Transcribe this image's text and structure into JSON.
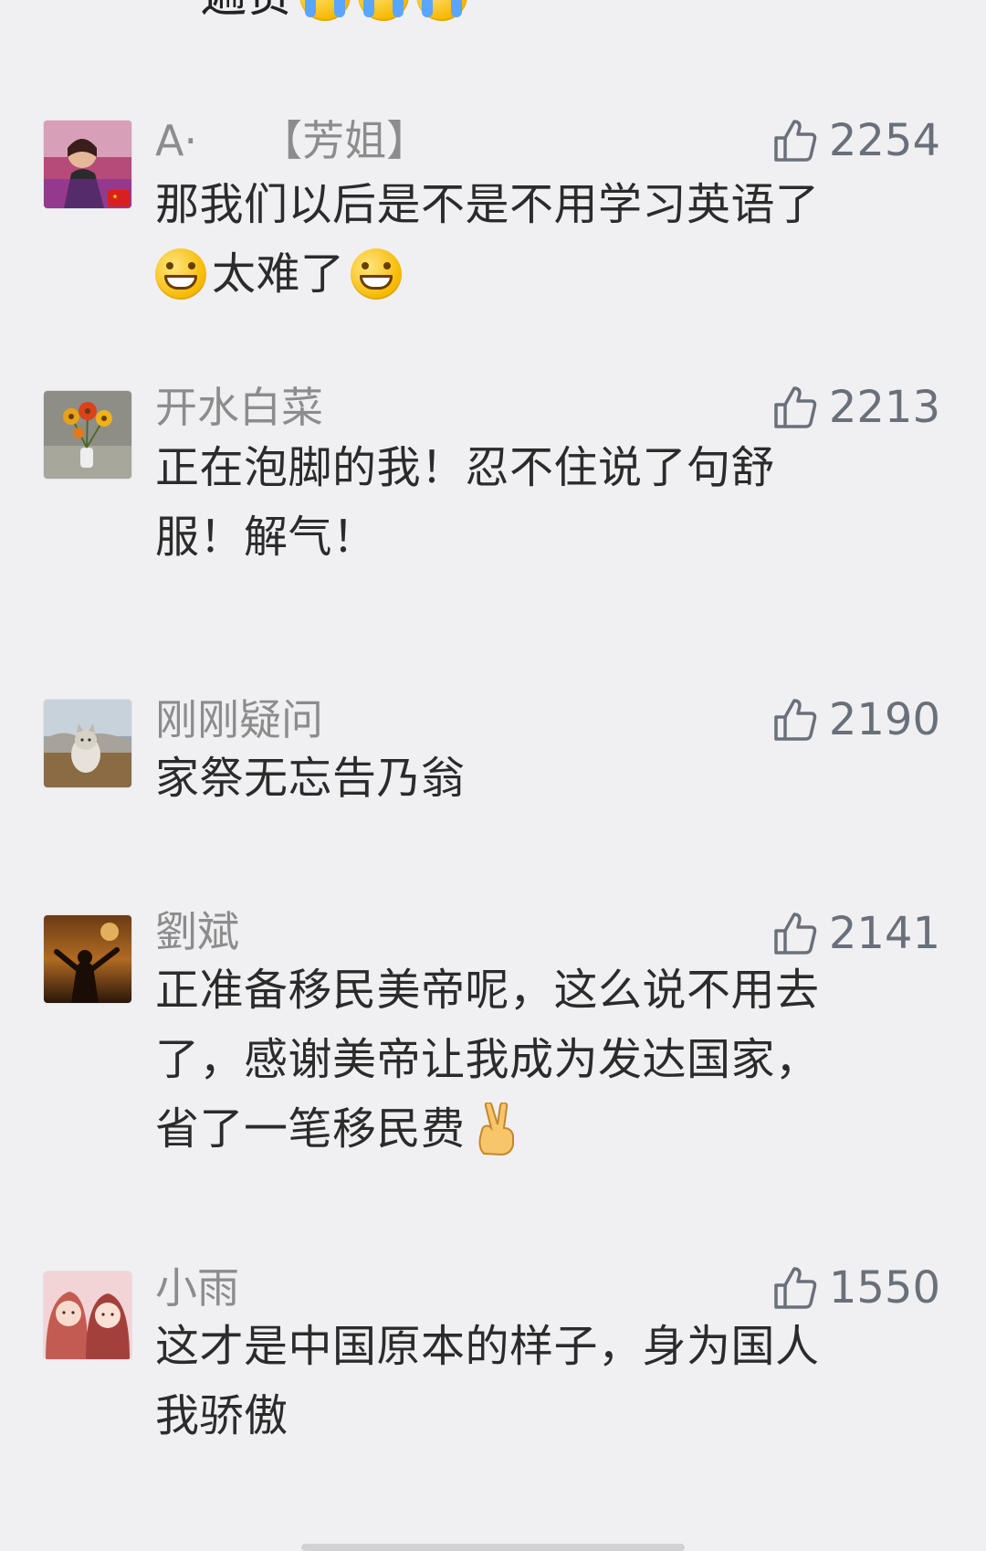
{
  "top_partial": {
    "text": "一遍赞",
    "emojis": [
      "crying-face-icon",
      "crying-face-icon",
      "crying-face-icon"
    ]
  },
  "comments": [
    {
      "avatar_icon": "avatar-woman-flag-icon",
      "name": "A·　　【芳姐】",
      "likes": "2254",
      "lines": [
        "那我们以后是不是不用学习英语了",
        "太难了"
      ],
      "emoji_line_2": [
        "grinning-face-icon",
        "grinning-face-icon"
      ]
    },
    {
      "avatar_icon": "avatar-flowers-icon",
      "name": "开水白菜",
      "likes": "2213",
      "lines": [
        "正在泡脚的我！忍不住说了句舒",
        "服！解气！"
      ]
    },
    {
      "avatar_icon": "avatar-cat-icon",
      "name": "刚刚疑问",
      "likes": "2190",
      "lines": [
        "家祭无忘告乃翁"
      ]
    },
    {
      "avatar_icon": "avatar-sunset-icon",
      "name": "劉斌",
      "likes": "2141",
      "lines": [
        "正准备移民美帝呢，这么说不用去",
        "了，感谢美帝让我成为发达国家，",
        "省了一笔移民费"
      ],
      "emoji_line_3": [
        "victory-hand-icon"
      ]
    },
    {
      "avatar_icon": "avatar-two-girls-icon",
      "name": "小雨",
      "likes": "1550",
      "lines": [
        "这才是中国原本的样子，身为国人",
        "我骄傲"
      ]
    }
  ],
  "colors": {
    "background": "#f0f0f3",
    "name_text": "#8c8c8c",
    "body_text": "#2b2b2b",
    "like_text": "#6a7079"
  }
}
